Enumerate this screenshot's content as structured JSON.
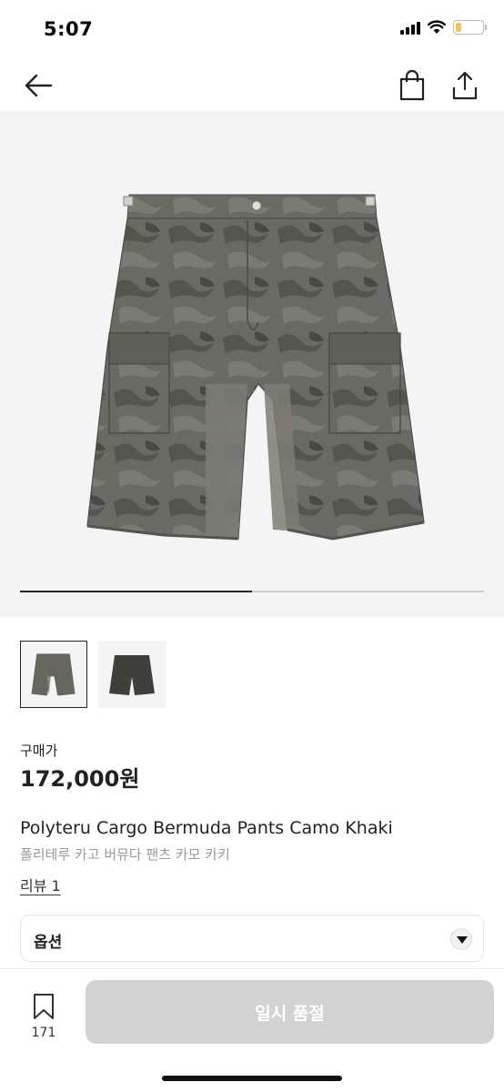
{
  "status_bar": {
    "time": "5:07"
  },
  "nav": {
    "back_icon": "arrow-left-icon",
    "bag_icon": "shopping-bag-icon",
    "share_icon": "share-icon"
  },
  "gallery": {
    "image_count": 2,
    "current_index": 1,
    "progress_fraction": 0.5,
    "thumbnails": [
      {
        "active": true
      },
      {
        "active": false
      }
    ]
  },
  "price": {
    "label": "구매가",
    "value": "172,000원"
  },
  "product": {
    "name_en": "Polyteru Cargo Bermuda Pants Camo Khaki",
    "name_ko": "폴리테루 카고 버뮤다 팬츠 카모 카키",
    "review_link": "리뷰 1"
  },
  "option": {
    "label": "옵션",
    "icon": "caret-down-icon"
  },
  "bottom": {
    "wish_icon": "bookmark-icon",
    "wish_count": "171",
    "cta_label": "일시 품절"
  },
  "colors": {
    "cta_disabled": "#d2d2d2",
    "battery": "#f2c94c",
    "hero_bg": "#f4f4f4"
  }
}
